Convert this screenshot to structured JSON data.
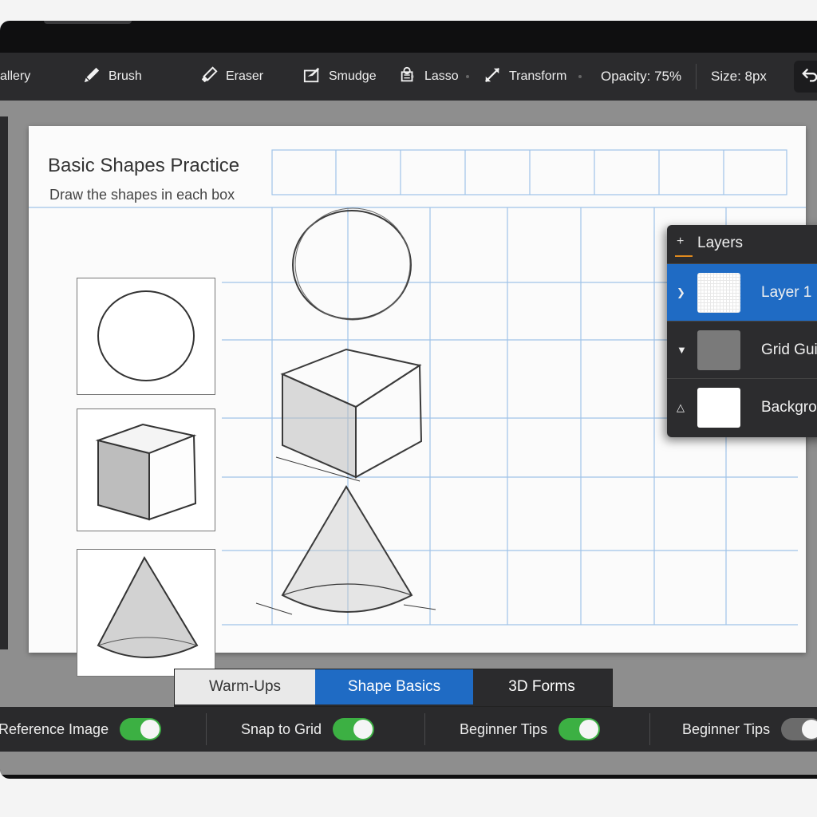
{
  "toolbar": {
    "gallery_label": "allery",
    "tools": [
      {
        "label": "Brush",
        "icon": "brush-icon"
      },
      {
        "label": "Eraser",
        "icon": "eraser-icon"
      },
      {
        "label": "Smudge",
        "icon": "smudge-icon"
      },
      {
        "label": "Lasso",
        "icon": "lasso-icon"
      },
      {
        "label": "Transform",
        "icon": "transform-icon"
      }
    ],
    "opacity_label": "Opacity: 75%",
    "size_label": "Size: 8px",
    "undo_icon": "undo-icon"
  },
  "worksheet": {
    "title": "Basic Shapes Practice",
    "subtitle": "Draw the shapes in each box",
    "reference_shapes": [
      "circle",
      "cube",
      "cone"
    ]
  },
  "layers": {
    "title": "Layers",
    "items": [
      {
        "name": "Layer 1",
        "active": true,
        "thumb": "transparent-grid"
      },
      {
        "name": "Grid Gui",
        "active": false,
        "thumb": "gray"
      },
      {
        "name": "Backgro",
        "active": false,
        "thumb": "white"
      }
    ]
  },
  "tabs": {
    "items": [
      "Warm-Ups",
      "Shape Basics",
      "3D Forms"
    ],
    "selected": "Shape Basics"
  },
  "bottom": {
    "toggles": [
      {
        "label": "Reference Image",
        "on": true
      },
      {
        "label": "Snap to Grid",
        "on": true
      },
      {
        "label": "Beginner Tips",
        "on": true
      },
      {
        "label": "Beginner Tips",
        "on": false
      }
    ]
  },
  "colors": {
    "accent_blue": "#1f6bc4",
    "toggle_on": "#3cb043",
    "toggle_off": "#6b6b6b",
    "grid_line": "#9fc3e8"
  }
}
